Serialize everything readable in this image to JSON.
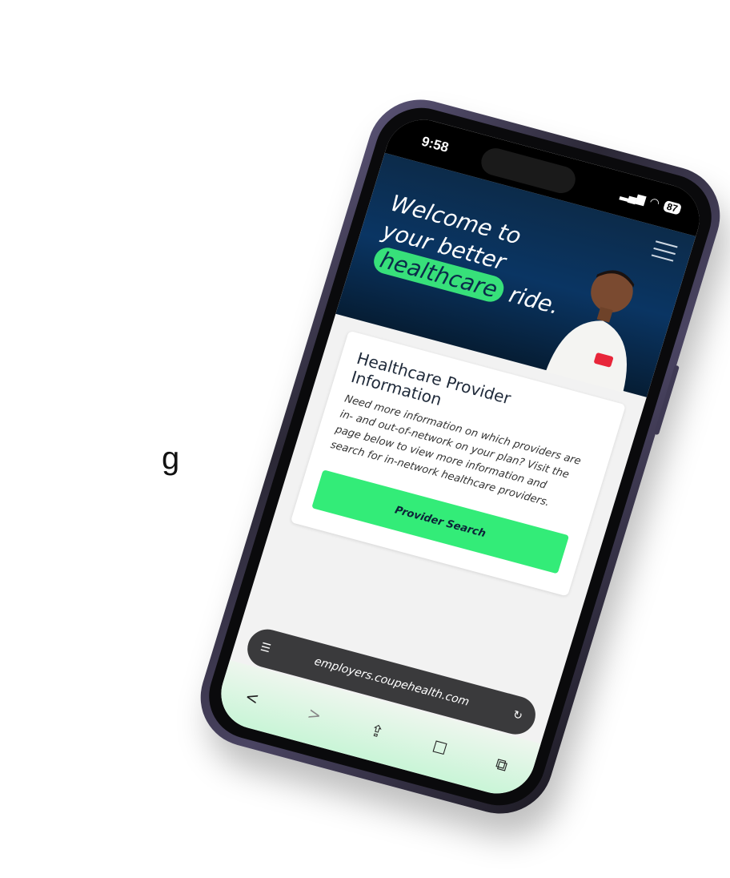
{
  "side_text": "g",
  "status_bar": {
    "time": "9:58",
    "signal": "▂▄▆",
    "wifi": "◠",
    "battery": "87"
  },
  "hero": {
    "line1": "Welcome to",
    "line2": "your better",
    "highlight": "healthcare",
    "line3_rest": "ride."
  },
  "card": {
    "title": "Healthcare Provider Information",
    "body": "Need more information on which providers are in- and out-of-network on your plan? Visit the page below to view more information and search for in-network healthcare providers.",
    "button_label": "Provider Search"
  },
  "browser": {
    "url": "employers.coupehealth.com",
    "reader_icon": "☰",
    "reload_icon": "↻"
  },
  "toolbar": {
    "back": "<",
    "forward": ">",
    "share": "⇪",
    "bookmarks": "☐",
    "tabs": "⧉"
  },
  "colors": {
    "accent_green": "#33ec78",
    "hero_navy": "#0a3563"
  }
}
